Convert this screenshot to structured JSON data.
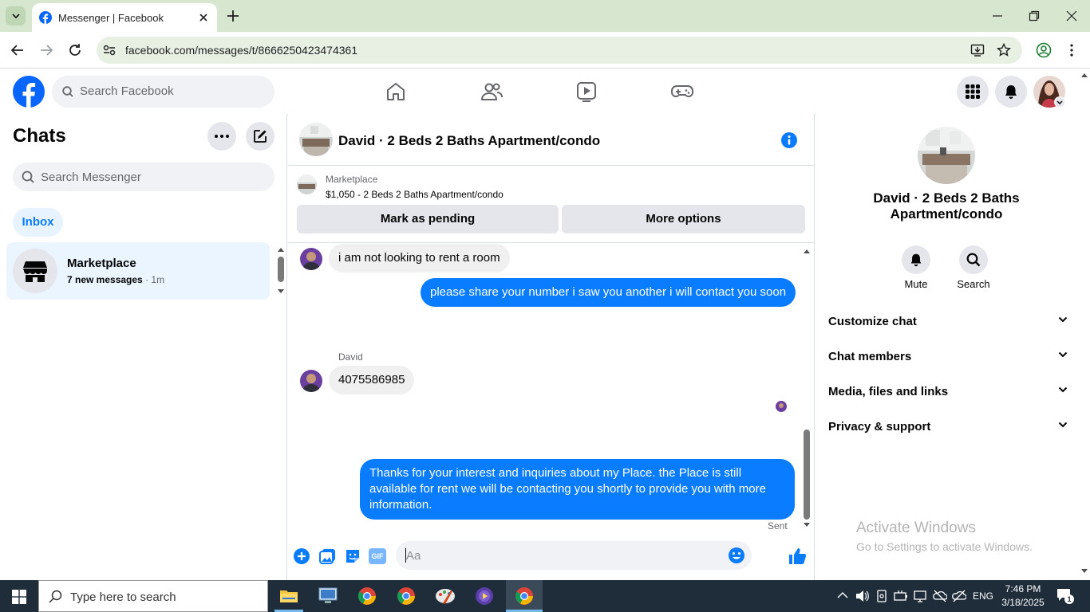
{
  "browser": {
    "tab_title": "Messenger | Facebook",
    "url": "facebook.com/messages/t/8666250423474361"
  },
  "fb_header": {
    "search_placeholder": "Search Facebook"
  },
  "chats_panel": {
    "title": "Chats",
    "search_placeholder": "Search Messenger",
    "filter_inbox": "Inbox",
    "conversations": [
      {
        "name": "Marketplace",
        "preview": "7 new messages",
        "time": "· 1m"
      }
    ]
  },
  "conversation": {
    "title": "David · 2 Beds 2 Baths Apartment/condo",
    "marketplace_label": "Marketplace",
    "listing": "$1,050 - 2 Beds 2 Baths Apartment/condo",
    "mark_pending": "Mark as pending",
    "more_options": "More options",
    "messages": [
      {
        "from": "David",
        "text": "i am not looking to rent a room"
      },
      {
        "from": "me",
        "text": "please share your number i saw you another i will contact you soon"
      },
      {
        "from": "David",
        "sender_label": "David",
        "text": "4075586985"
      },
      {
        "from": "me",
        "text": "Thanks for your interest and inquiries about my Place. the Place is still available for rent we will be contacting you shortly to provide you with more information."
      }
    ],
    "status": "Sent",
    "composer_placeholder": "Aa",
    "gif_label": "GIF"
  },
  "details_panel": {
    "name": "David · 2 Beds 2 Baths Apartment/condo",
    "mute_label": "Mute",
    "search_label": "Search",
    "sections": [
      "Customize chat",
      "Chat members",
      "Media, files and links",
      "Privacy & support"
    ]
  },
  "watermark": {
    "line1": "Activate Windows",
    "line2": "Go to Settings to activate Windows."
  },
  "taskbar": {
    "search_placeholder": "Type here to search",
    "language": "ENG",
    "time": "7:46 PM",
    "date": "3/18/2025",
    "notification_count": "1"
  },
  "colors": {
    "accent": "#0a7cff",
    "fb_blue": "#0866ff",
    "chrome_frame": "#d6e6cf",
    "taskbar": "#1f2d3a"
  }
}
